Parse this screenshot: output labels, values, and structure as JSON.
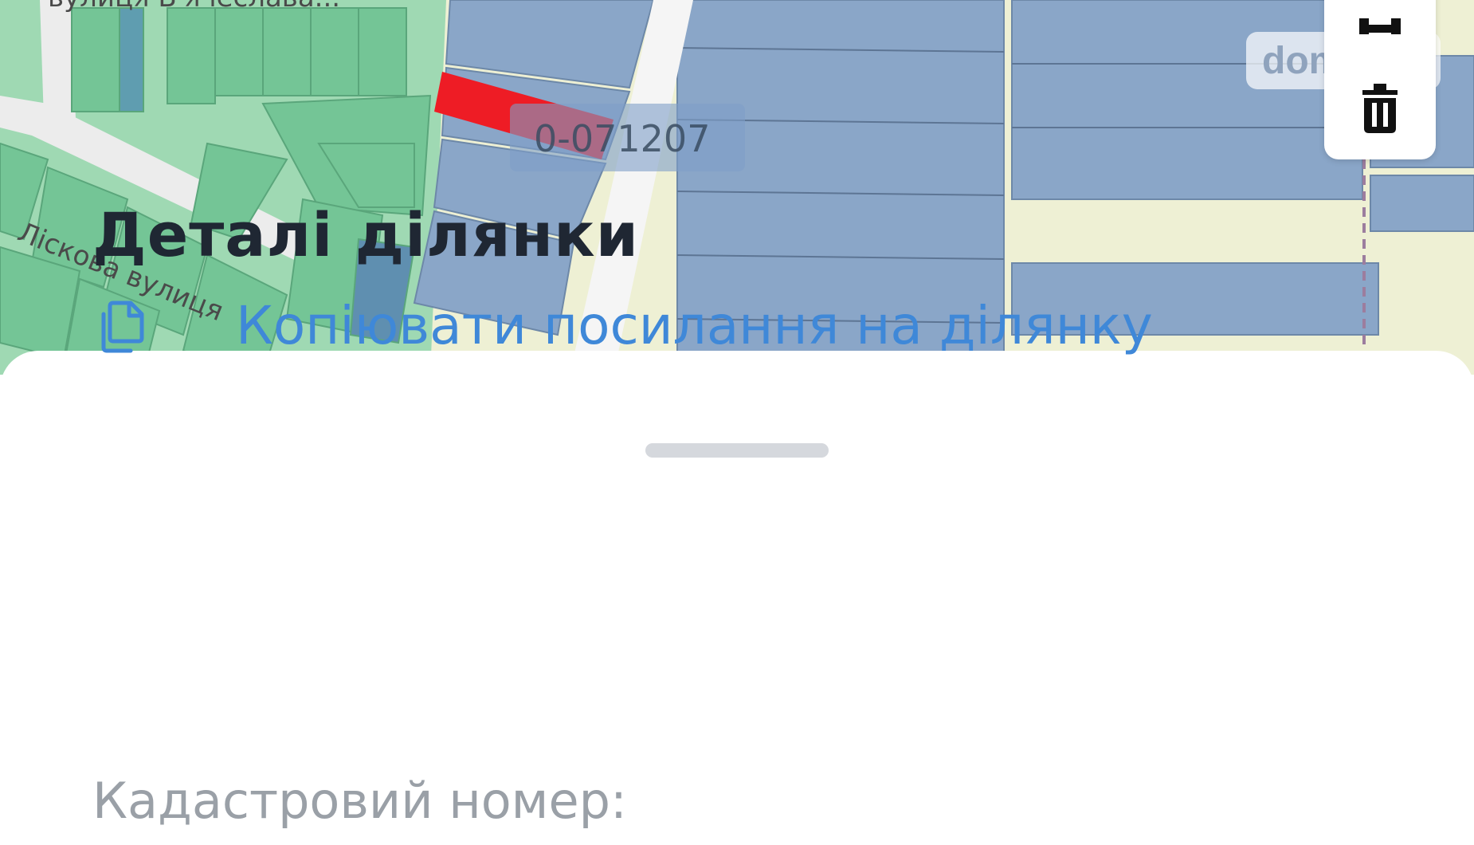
{
  "colors": {
    "accent_link": "#3f88d8",
    "title_text": "#1f2733",
    "muted_text": "#9aa0a7",
    "parcel_blue": "#8aa6c8",
    "parcel_green": "#74c596",
    "selected_parcel": "#ee1c25",
    "sheet_handle": "#d5d8dd"
  },
  "map": {
    "street_labels": [
      "вулиця В'ячеслава...",
      "Ліскова вулиця"
    ],
    "parcel_label": "0-071207",
    "watermark": "dom",
    "tools": [
      {
        "name": "draw-tool",
        "icon": "polygon-icon"
      },
      {
        "name": "delete-tool",
        "icon": "trash-icon"
      }
    ]
  },
  "sheet": {
    "title": "Деталі ділянки",
    "copy_link_label": "Копіювати посилання на ділянку",
    "copy_icon": "copy-icon",
    "cadastral_label": "Кадастровий номер:"
  }
}
